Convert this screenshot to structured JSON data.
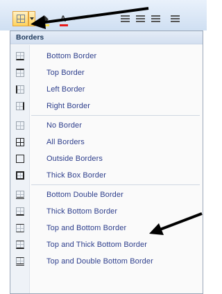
{
  "menu": {
    "header": "Borders",
    "items": [
      {
        "label": "Bottom Border",
        "icon": "bottom-border-icon"
      },
      {
        "label": "Top Border",
        "icon": "top-border-icon"
      },
      {
        "label": "Left Border",
        "icon": "left-border-icon"
      },
      {
        "label": "Right Border",
        "icon": "right-border-icon"
      },
      {
        "label": "No Border",
        "icon": "no-border-icon"
      },
      {
        "label": "All Borders",
        "icon": "all-borders-icon"
      },
      {
        "label": "Outside Borders",
        "icon": "outside-borders-icon"
      },
      {
        "label": "Thick Box Border",
        "icon": "thick-box-border-icon"
      },
      {
        "label": "Bottom Double Border",
        "icon": "bottom-double-border-icon"
      },
      {
        "label": "Thick Bottom Border",
        "icon": "thick-bottom-border-icon"
      },
      {
        "label": "Top and Bottom Border",
        "icon": "top-and-bottom-border-icon"
      },
      {
        "label": "Top and Thick Bottom Border",
        "icon": "top-and-thick-bottom-border-icon"
      },
      {
        "label": "Top and Double Bottom Border",
        "icon": "top-and-double-bottom-border-icon"
      }
    ]
  },
  "toolbar": {
    "icons": [
      "borders-icon",
      "fill-color-icon",
      "font-color-icon",
      "align-left-icon",
      "align-center-icon",
      "align-right-icon",
      "decrease-indent-icon"
    ]
  },
  "colors": {
    "highlight": "#ffe34d",
    "font_color": "#e81a1a",
    "menu_text": "#2d3e8c",
    "header_text": "#1e395b"
  }
}
